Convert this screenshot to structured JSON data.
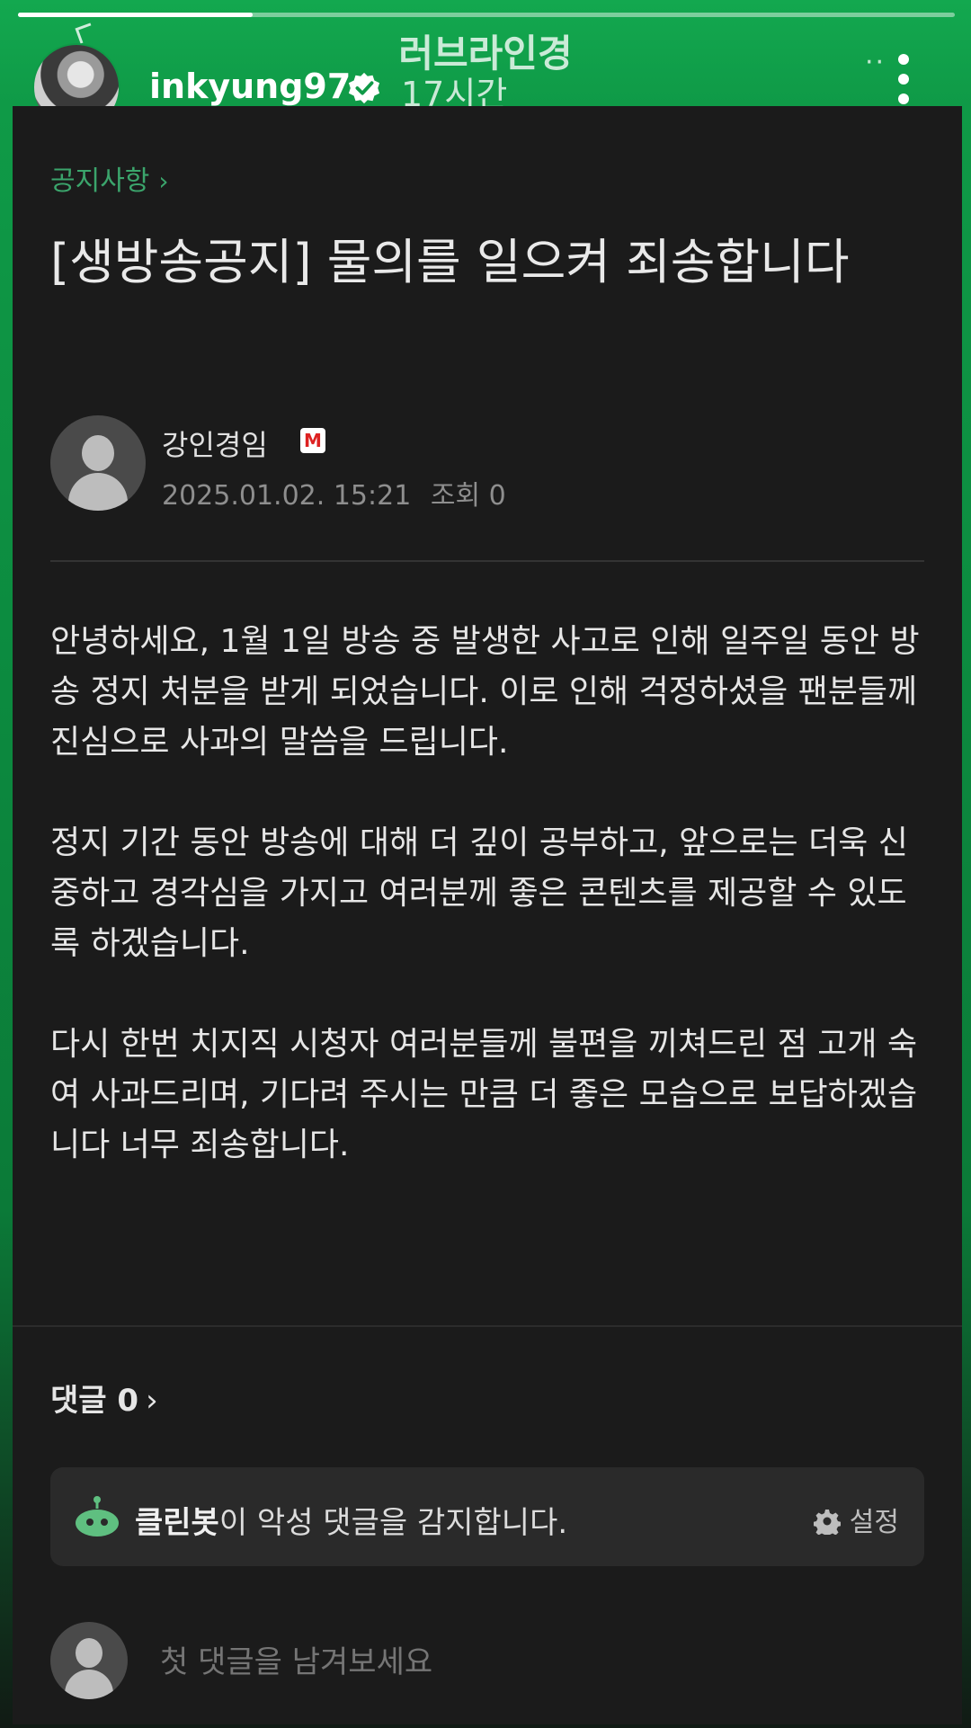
{
  "story": {
    "title": "러브라인경",
    "username": "inkyung97",
    "time": "17시간",
    "progress": 0.25,
    "more_dots": "··"
  },
  "post": {
    "breadcrumb": "공지사항",
    "breadcrumb_chevron": "›",
    "title": "[생방송공지] 물의를 일으켜 죄송합니다",
    "author": "강인경임",
    "badge": "M",
    "date": "2025.01.02. 15:21",
    "views": "조회 0",
    "paragraphs": [
      "안녕하세요, 1월 1일 방송 중 발생한 사고로 인해 일주일 동안 방송 정지 처분을 받게 되었습니다. 이로 인해 걱정하셨을 팬분들께 진심으로 사과의 말씀을 드립니다.",
      "정지 기간 동안 방송에 대해 더 깊이 공부하고, 앞으로는 더욱 신중하고 경각심을 가지고 여러분께 좋은 콘텐츠를 제공할 수 있도록 하겠습니다.",
      "다시 한번 치지직 시청자 여러분들께 불편을 끼쳐드린 점 고개 숙여 사과드리며, 기다려 주시는 만큼 더 좋은 모습으로 보답하겠습니다 너무 죄송합니다."
    ]
  },
  "comments": {
    "label": "댓글 0",
    "chevron": "›"
  },
  "cleanbot": {
    "name": "클린봇",
    "message": "이 악성 댓글을 감지합니다.",
    "settings_label": "설정"
  },
  "comment_input": {
    "placeholder": "첫 댓글을 남겨보세요"
  },
  "colors": {
    "accent_green": "#13a84f",
    "breadcrumb_green": "#3ba56c",
    "card_bg": "#1b1b1b"
  }
}
